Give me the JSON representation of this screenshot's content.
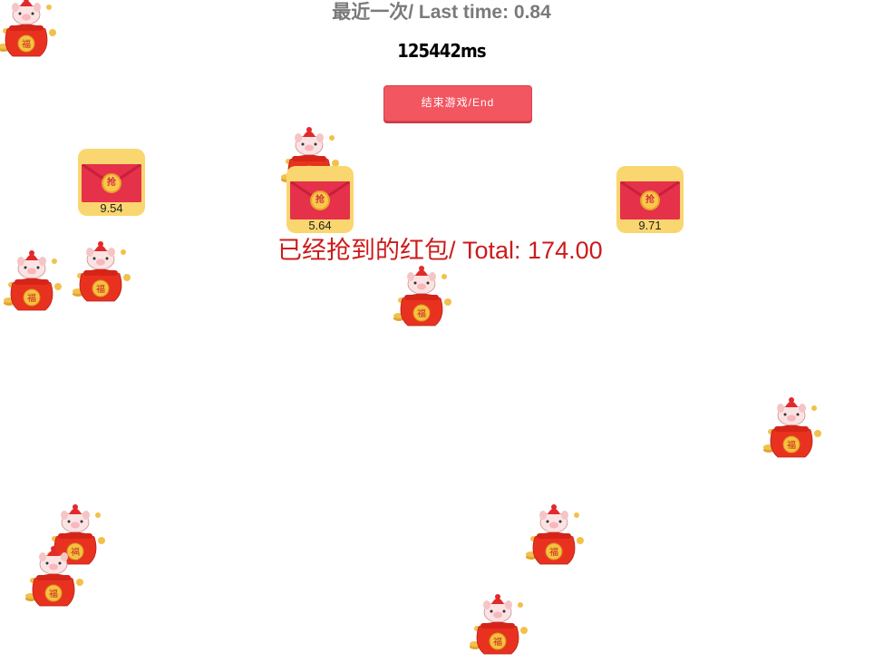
{
  "header": {
    "last_time_label": "最近一次/ Last time: 0.84",
    "timer": "125442ms",
    "end_button_label": "结束游戏/End"
  },
  "total": {
    "label": "已经抢到的红包/ Total: 174.00"
  },
  "envelopes": [
    {
      "amount": "9.54",
      "seal": "抢"
    },
    {
      "amount": "5.64",
      "seal": "抢"
    },
    {
      "amount": "9.71",
      "seal": "抢"
    }
  ],
  "pig_seal_char": "福",
  "colors": {
    "envelope_frame": "#f9d66f",
    "envelope_body": "#e5314a",
    "end_button": "#f25661",
    "total_text": "#cc1b1b",
    "bag": "#e8321f"
  }
}
